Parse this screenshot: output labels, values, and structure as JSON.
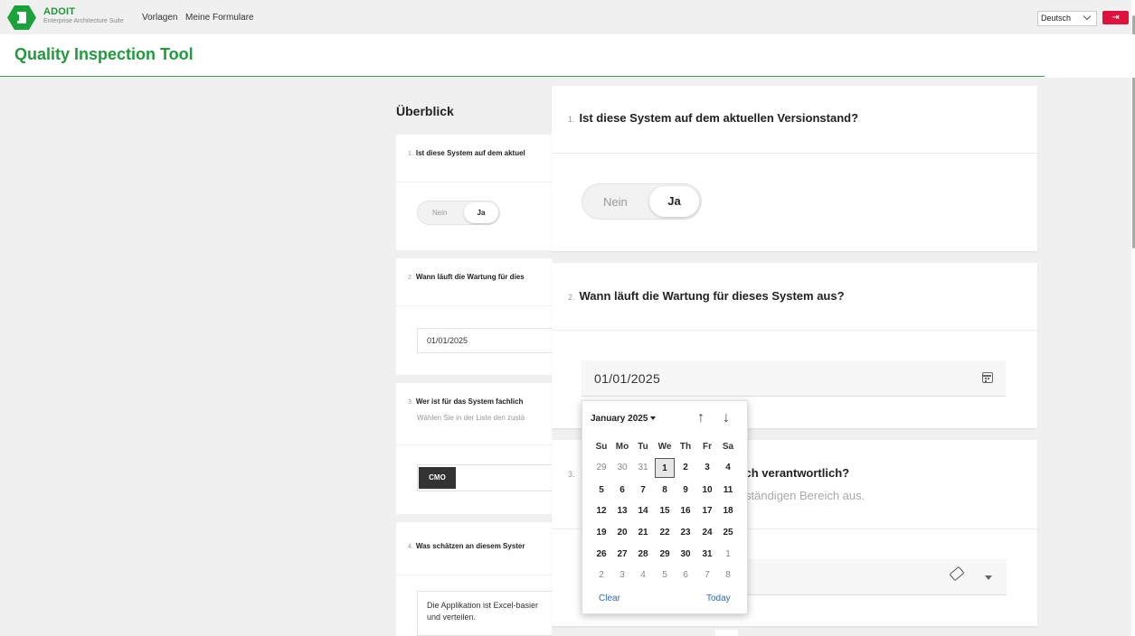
{
  "header": {
    "brand_name": "ADOIT",
    "brand_subtitle": "Enterprise Architecture Suite",
    "nav": [
      "Vorlagen",
      "Meine Formulare"
    ],
    "language": "Deutsch",
    "logout_icon": "logout-icon",
    "accent_color": "#1f9a3c",
    "logout_color": "#e0113c"
  },
  "page": {
    "title": "Quality Inspection Tool"
  },
  "overview": {
    "title": "Überblick",
    "items": [
      {
        "num": "1.",
        "question": "Ist diese System auf dem aktuel",
        "no": "Nein",
        "yes": "Ja"
      },
      {
        "num": "2.",
        "question": "Wann läuft die Wartung für dies",
        "value": "01/01/2025"
      },
      {
        "num": "3.",
        "question": "Wer ist für das System fachlich",
        "subtitle": "Wählen Sie in der Liste den zustä",
        "chip": "CMO"
      },
      {
        "num": "4.",
        "question": "Was schätzen an diesem Syster",
        "text_line1": "Die Applikation ist Excel-basier",
        "text_line2": "und verteilen."
      }
    ]
  },
  "questions": [
    {
      "num": "1.",
      "question": "Ist diese System auf dem aktuellen Versionstand?",
      "no": "Nein",
      "yes": "Ja",
      "selected": "Ja"
    },
    {
      "num": "2.",
      "question": "Wann läuft die Wartung für dieses System aus?",
      "value": "01/01/2025"
    },
    {
      "num": "3.",
      "question_visible": "ch verantwortlich?",
      "subtitle_visible": "ständigen Bereich aus."
    }
  ],
  "datepicker": {
    "month_label": "January 2025",
    "weekdays": [
      "Su",
      "Mo",
      "Tu",
      "We",
      "Th",
      "Fr",
      "Sa"
    ],
    "weeks": [
      [
        "29",
        "30",
        "31",
        "1",
        "2",
        "3",
        "4"
      ],
      [
        "5",
        "6",
        "7",
        "8",
        "9",
        "10",
        "11"
      ],
      [
        "12",
        "13",
        "14",
        "15",
        "16",
        "17",
        "18"
      ],
      [
        "19",
        "20",
        "21",
        "22",
        "23",
        "24",
        "25"
      ],
      [
        "26",
        "27",
        "28",
        "29",
        "30",
        "31",
        "1"
      ],
      [
        "2",
        "3",
        "4",
        "5",
        "6",
        "7",
        "8"
      ]
    ],
    "selected_day": "1",
    "clear_label": "Clear",
    "today_label": "Today"
  }
}
